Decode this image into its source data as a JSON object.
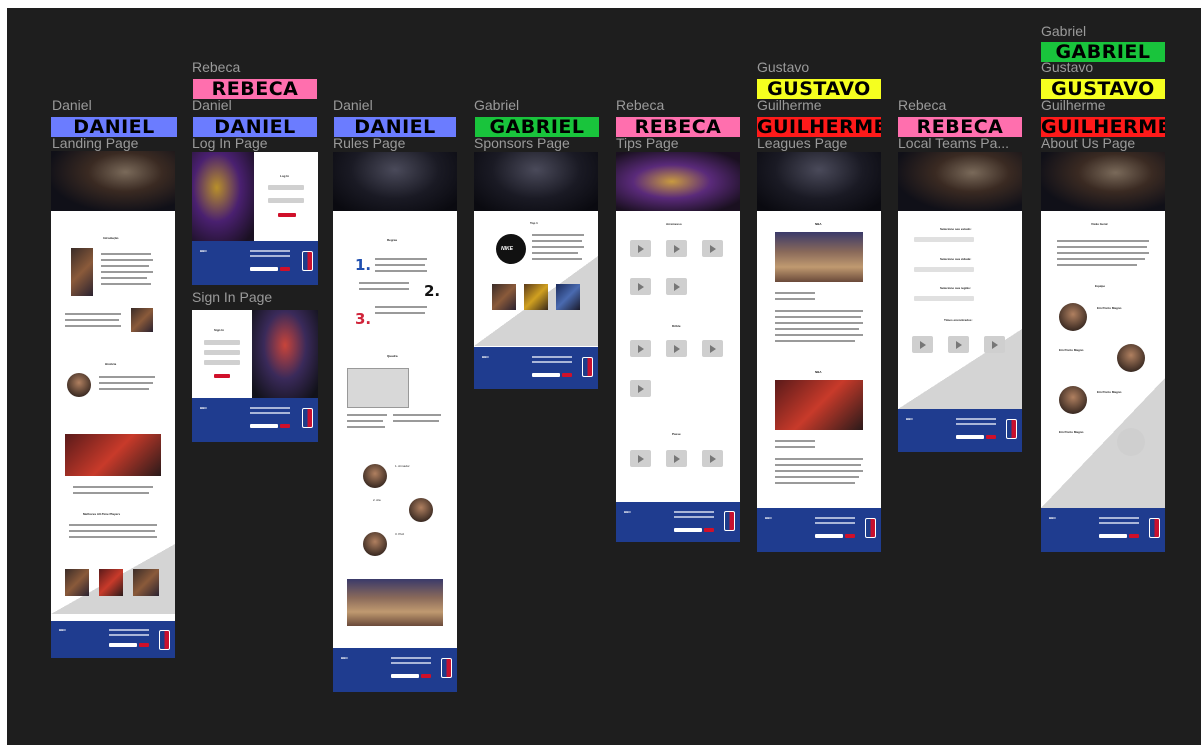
{
  "tags": {
    "daniel": "DANIEL",
    "rebeca": "REBECA",
    "gabriel": "GABRIEL",
    "gustavo": "GUSTAVO",
    "guilherme": "GUILHERME"
  },
  "names": {
    "daniel": "Daniel",
    "rebeca": "Rebeca",
    "gabriel": "Gabriel",
    "gustavo": "Gustavo",
    "guilherme": "Guilherme"
  },
  "pages": {
    "landing": "Landing Page",
    "login": "Log In Page",
    "signin": "Sign In Page",
    "rules": "Rules Page",
    "sponsors": "Sponsors Page",
    "tips": "Tips Page",
    "leagues": "Leagues Page",
    "local": "Local Teams Pa...",
    "about": "About Us Page"
  },
  "colors": {
    "daniel": "#6b7cff",
    "rebeca": "#ff6fae",
    "gabriel": "#19c43c",
    "gustavo": "#f5ff1f",
    "guilherme": "#ff1a1a",
    "canvas": "#1e1e1e",
    "footer": "#1f3c8f"
  },
  "frames": {
    "brand": "BBN",
    "landing": {
      "sections": [
        "Introdução",
        "História",
        "Melhores All-Time Players"
      ]
    },
    "login": {
      "title": "Log In",
      "button": "Entrar"
    },
    "signin": {
      "title": "Sign In"
    },
    "rules": {
      "heading": "Regras",
      "numbers": [
        "1.",
        "2.",
        "3."
      ],
      "posicoes": "Quadra",
      "roles": [
        "1. Armador",
        "2. Ala",
        "3. Pivô"
      ]
    },
    "sponsors": {
      "title": "Top 1",
      "brand": "NIKE"
    },
    "tips": {
      "sections": [
        "Arremesso",
        "Drible",
        "Passe"
      ]
    },
    "leagues": {
      "top": "NBA",
      "second": "NBA"
    },
    "local": {
      "selects": [
        "Selecione seu estado:",
        "Selecione sua cidade:",
        "Selecione sua região:"
      ],
      "result": "Times encontrados:"
    },
    "about": {
      "vision": "Visão Geral",
      "team": "Equipe",
      "member": "Ein Ponto Magno"
    }
  }
}
